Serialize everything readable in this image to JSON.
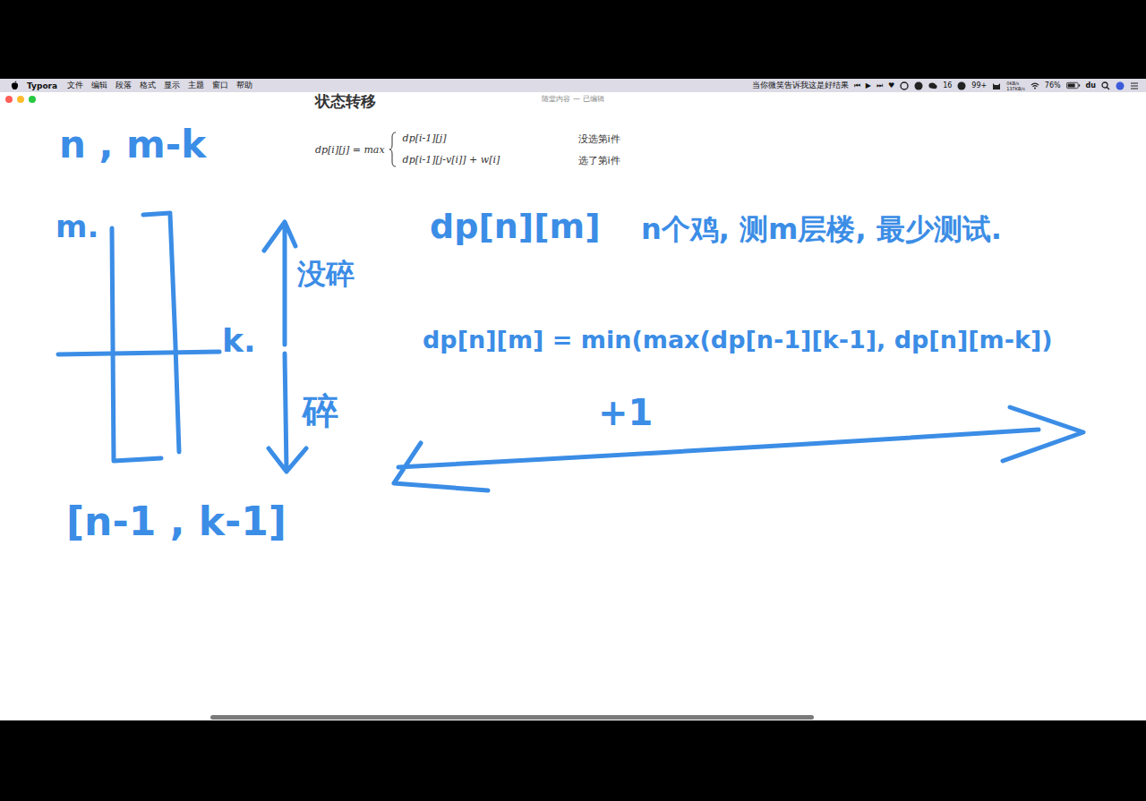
{
  "menu_bar": {
    "app": "Typora",
    "menus": [
      "文件",
      "编辑",
      "段落",
      "格式",
      "显示",
      "主题",
      "窗口",
      "帮助"
    ],
    "song": "当你微笑告诉我这是好结果",
    "controls": [
      "⏮",
      "▶",
      "⏭",
      "♥"
    ],
    "badges": [
      "16",
      "99+"
    ],
    "net": [
      "0KB/s",
      "137KB/s"
    ],
    "battery": "76%",
    "extra": "du"
  },
  "window": {
    "title": "随堂内容 — 已编辑"
  },
  "document": {
    "heading": "状态转移",
    "formula": {
      "lhs": "dp[i][j] = max",
      "cases": [
        {
          "expr": "dp[i-1][j]",
          "note": "没选第i件"
        },
        {
          "expr": "dp[i-1][j-v[i]] + w[i]",
          "note": "选了第i件"
        }
      ]
    }
  },
  "annotations": {
    "given": "n , m-k",
    "floors": "m.",
    "split": "k.",
    "not_broken": "没碎",
    "broken": "碎",
    "sub": "[n-1 , k-1]",
    "state": "dp[n][m]",
    "meaning": "n个鸡, 测m层楼, 最少测试.",
    "transition": "dp[n][m] = min(max(dp[n-1][k-1], dp[n][m-k])",
    "plus": "+1"
  },
  "scrollbar": {
    "level": 0.645
  }
}
